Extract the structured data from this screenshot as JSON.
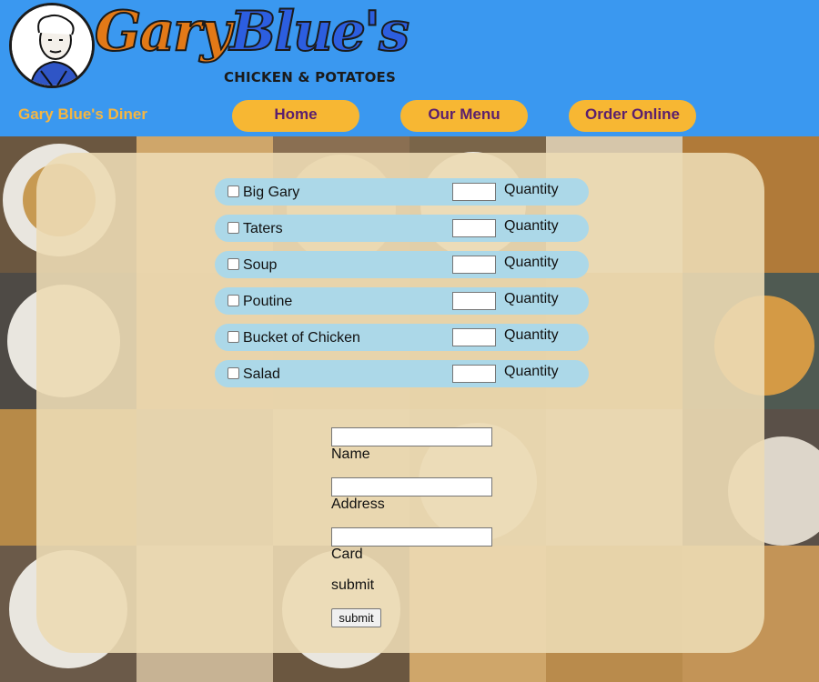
{
  "header": {
    "logo": {
      "name_part1": "Gary",
      "name_part2": "Blue's",
      "tagline": "CHICKEN & POTATOES"
    },
    "site_name": "Gary Blue's Diner",
    "nav": [
      {
        "label": "Home"
      },
      {
        "label": "Our Menu"
      },
      {
        "label": "Order Online"
      }
    ]
  },
  "order": {
    "quantity_label": "Quantity",
    "items": [
      {
        "name": "Big Gary",
        "checked": false,
        "quantity": ""
      },
      {
        "name": "Taters",
        "checked": false,
        "quantity": ""
      },
      {
        "name": "Soup",
        "checked": false,
        "quantity": ""
      },
      {
        "name": "Poutine",
        "checked": false,
        "quantity": ""
      },
      {
        "name": "Bucket of Chicken",
        "checked": false,
        "quantity": ""
      },
      {
        "name": "Salad",
        "checked": false,
        "quantity": ""
      }
    ]
  },
  "form": {
    "fields": [
      {
        "label": "Name",
        "value": ""
      },
      {
        "label": "Address",
        "value": ""
      },
      {
        "label": "Card",
        "value": ""
      }
    ],
    "submit_caption": "submit",
    "submit_button": "submit"
  },
  "colors": {
    "header_bg": "#3a98f0",
    "nav_button": "#f7b733",
    "nav_text": "#5b1f6e",
    "site_name": "#f5b642",
    "item_row": "#acd8e8",
    "panel": "#ecdab4"
  }
}
